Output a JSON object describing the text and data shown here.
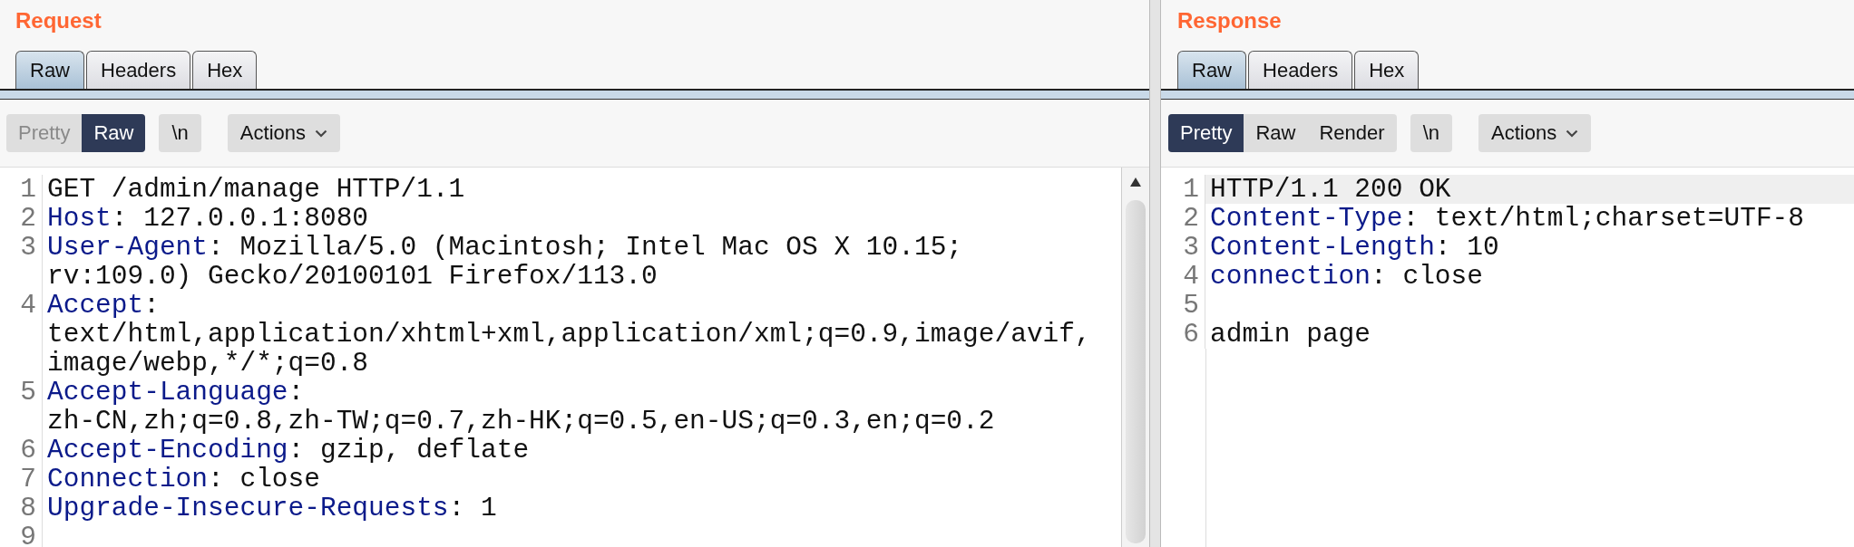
{
  "panes": [
    {
      "title": "Request",
      "scrollbar": true,
      "tabs": [
        {
          "label": "Raw",
          "selected": true
        },
        {
          "label": "Headers",
          "selected": false
        },
        {
          "label": "Hex",
          "selected": false
        }
      ],
      "view_modes": [
        {
          "label": "Pretty",
          "selected": false,
          "disabled": true
        },
        {
          "label": "Raw",
          "selected": true,
          "disabled": false
        }
      ],
      "newline_toggle": "\\n",
      "actions": "Actions",
      "lines": [
        {
          "number": "1",
          "text": "GET /admin/manage HTTP/1.1",
          "current": false
        },
        {
          "number": "2",
          "name": "Host",
          "text": ": 127.0.0.1:8080",
          "current": false
        },
        {
          "number": "3",
          "name": "User-Agent",
          "text": ": Mozilla/5.0 (Macintosh; Intel Mac OS X 10.15;",
          "wrapped": [
            "rv:109.0) Gecko/20100101 Firefox/113.0"
          ],
          "current": false
        },
        {
          "number": "4",
          "name": "Accept",
          "text": ":",
          "wrapped": [
            "text/html,application/xhtml+xml,application/xml;q=0.9,image/avif,",
            "image/webp,*/*;q=0.8"
          ],
          "current": false
        },
        {
          "number": "5",
          "name": "Accept-Language",
          "text": ":",
          "wrapped": [
            "zh-CN,zh;q=0.8,zh-TW;q=0.7,zh-HK;q=0.5,en-US;q=0.3,en;q=0.2"
          ],
          "current": false
        },
        {
          "number": "6",
          "name": "Accept-Encoding",
          "text": ": gzip, deflate",
          "current": false
        },
        {
          "number": "7",
          "name": "Connection",
          "text": ": close",
          "current": false
        },
        {
          "number": "8",
          "name": "Upgrade-Insecure-Requests",
          "text": ": 1",
          "current": false
        },
        {
          "number": "9",
          "current": false
        }
      ]
    },
    {
      "title": "Response",
      "tabs": [
        {
          "label": "Raw",
          "selected": true
        },
        {
          "label": "Headers",
          "selected": false
        },
        {
          "label": "Hex",
          "selected": false
        }
      ],
      "view_modes": [
        {
          "label": "Pretty",
          "selected": true,
          "disabled": false
        },
        {
          "label": "Raw",
          "selected": false,
          "disabled": false
        },
        {
          "label": "Render",
          "selected": false,
          "disabled": false
        }
      ],
      "newline_toggle": "\\n",
      "actions": "Actions",
      "lines": [
        {
          "number": "1",
          "text": "HTTP/1.1 200 OK",
          "current": true
        },
        {
          "number": "2",
          "name": "Content-Type",
          "text": ": text/html;charset=UTF-8",
          "current": false
        },
        {
          "number": "3",
          "name": "Content-Length",
          "text": ": 10",
          "current": false
        },
        {
          "number": "4",
          "name": "connection",
          "text": ": close",
          "current": false
        },
        {
          "number": "5",
          "current": false
        },
        {
          "number": "6",
          "text": "admin page",
          "current": false
        }
      ]
    }
  ]
}
